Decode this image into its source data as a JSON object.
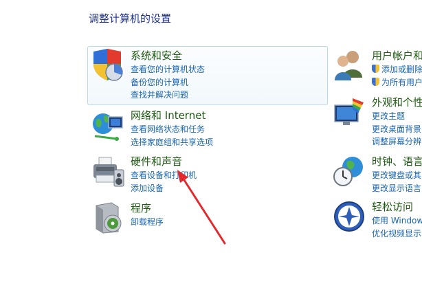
{
  "page_title": "调整计算机的设置",
  "categories": [
    {
      "title": "系统和安全",
      "links": [
        "查看您的计算机状态",
        "备份您的计算机",
        "查找并解决问题"
      ]
    },
    {
      "title": "网络和 Internet",
      "links": [
        "查看网络状态和任务",
        "选择家庭组和共享选项"
      ]
    },
    {
      "title": "硬件和声音",
      "links": [
        "查看设备和打印机",
        "添加设备"
      ]
    },
    {
      "title": "程序",
      "links": [
        "卸载程序"
      ]
    },
    {
      "title": "用户帐户和",
      "links": [
        "添加或删除",
        "为所有用户"
      ]
    },
    {
      "title": "外观和个性",
      "links": [
        "更改主题",
        "更改桌面背景",
        "调整屏幕分辨"
      ]
    },
    {
      "title": "时钟、语言",
      "links": [
        "更改键盘或其",
        "更改显示语言"
      ]
    },
    {
      "title": "轻松访问",
      "links": [
        "使用 Windows",
        "优化视频显示"
      ]
    }
  ],
  "icons": {
    "system_security": "shield-chart-icon",
    "network": "globe-network-icon",
    "hardware": "printer-speaker-icon",
    "programs": "software-box-icon",
    "user_accounts": "users-icon",
    "appearance": "monitor-paint-icon",
    "clock": "clock-globe-icon",
    "ease_of_access": "ease-of-access-icon"
  },
  "colors": {
    "title": "#1e3287",
    "category_title": "#1e5a12",
    "link": "#1a66b3",
    "highlight_border": "#b9d9ec",
    "arrow": "#e3292b"
  }
}
